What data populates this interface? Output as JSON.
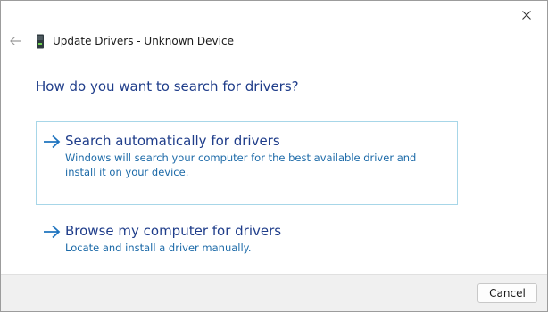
{
  "header": {
    "title": "Update Drivers - Unknown Device",
    "back_icon": "back-arrow-icon",
    "device_icon": "device-icon",
    "close_icon": "close-icon"
  },
  "main": {
    "question": "How do you want to search for drivers?",
    "options": [
      {
        "title": "Search automatically for drivers",
        "description": "Windows will search your computer for the best available driver and install it on your device.",
        "icon": "arrow-right-icon",
        "selected": true
      },
      {
        "title": "Browse my computer for drivers",
        "description": "Locate and install a driver manually.",
        "icon": "arrow-right-icon",
        "selected": false
      }
    ]
  },
  "footer": {
    "cancel_label": "Cancel"
  },
  "colors": {
    "link_title": "#1f3d8a",
    "link_desc": "#1c6aa8",
    "selection_border": "#a7d6e8",
    "footer_bg": "#f0f0f0"
  }
}
